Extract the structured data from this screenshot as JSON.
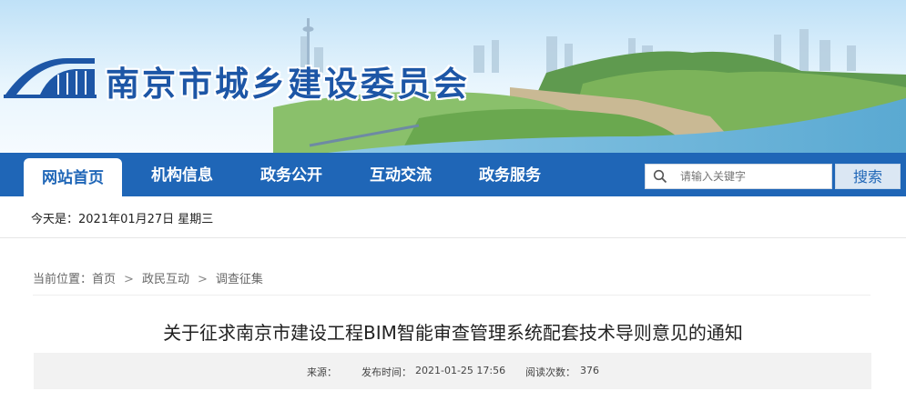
{
  "site": {
    "name": "南京市城乡建设委员会"
  },
  "nav": {
    "items": [
      {
        "label": "网站首页",
        "active": true
      },
      {
        "label": "机构信息",
        "active": false
      },
      {
        "label": "政务公开",
        "active": false
      },
      {
        "label": "互动交流",
        "active": false
      },
      {
        "label": "政务服务",
        "active": false
      }
    ]
  },
  "search": {
    "placeholder": "请输入关键字",
    "button_label": "搜索"
  },
  "date": {
    "text": "今天是：2021年01月27日 星期三"
  },
  "breadcrumb": {
    "prefix": "当前位置：",
    "items": [
      "首页",
      "政民互动",
      "调查征集"
    ],
    "separator": ">"
  },
  "article": {
    "title": "关于征求南京市建设工程BIM智能审查管理系统配套技术导则意见的通知",
    "source_label": "来源：",
    "source_value": "",
    "publish_label": "发布时间：",
    "publish_value": "2021-01-25 17:56",
    "views_label": "阅读次数：",
    "views_value": "376"
  },
  "colors": {
    "brand_blue": "#1f66b7",
    "title_blue": "#1d56a6",
    "meta_bg": "#f2f2f2"
  }
}
